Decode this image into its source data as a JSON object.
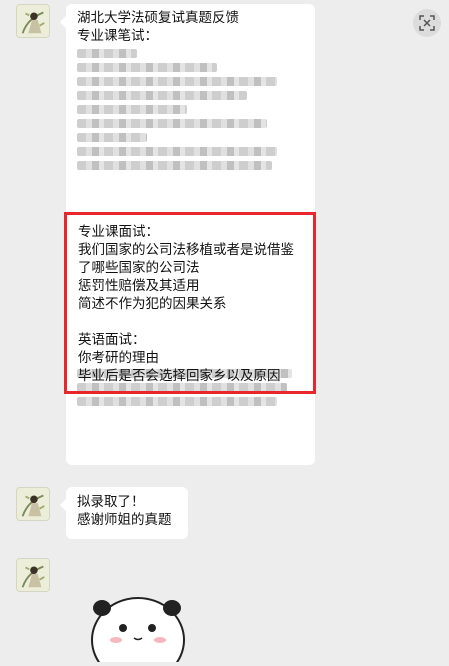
{
  "messages": [
    {
      "title": "湖北大学法硕复试真题反馈",
      "section_written": "专业课笔试：",
      "section_oral": "专业课面试：",
      "oral_q1_line1": "我们国家的公司法移植或者是说借鉴",
      "oral_q1_line2": "了哪些国家的公司法",
      "oral_q2": "惩罚性赔偿及其适用",
      "oral_q3": "简述不作为犯的因果关系",
      "section_english": "英语面试：",
      "english_q1": "你考研的理由",
      "english_q2": "毕业后是否会选择回家乡以及原因"
    },
    {
      "line1": "拟录取了！",
      "line2": "感谢师姐的真题"
    }
  ],
  "icons": {
    "close": "close-icon",
    "avatar": "avatar-image",
    "sticker": "panda-sticker"
  },
  "colors": {
    "background": "#ededed",
    "bubble": "#ffffff",
    "highlight": "#e8262b"
  }
}
